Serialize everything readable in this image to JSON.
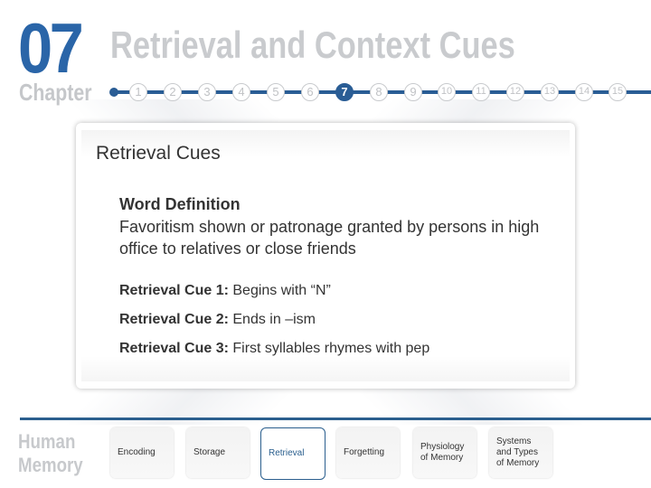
{
  "header": {
    "chapter_number": "07",
    "chapter_label": "Chapter",
    "title": "Retrieval and Context Cues",
    "steps": [
      "1",
      "2",
      "3",
      "4",
      "5",
      "6",
      "7",
      "8",
      "9",
      "10",
      "11",
      "12",
      "13",
      "14",
      "15"
    ],
    "active_step": "7"
  },
  "card": {
    "title": "Retrieval Cues",
    "definition_heading": "Word Definition",
    "definition_text": "Favoritism shown or patronage granted by persons in high office to relatives or close friends",
    "cues": [
      {
        "label": "Retrieval Cue 1:",
        "text": " Begins with “N”"
      },
      {
        "label": "Retrieval Cue 2:",
        "text": " Ends in –ism"
      },
      {
        "label": "Retrieval Cue 3:",
        "text": " First syllables rhymes with pep"
      }
    ]
  },
  "footer": {
    "section_line1": "Human",
    "section_line2": "Memory",
    "nav": [
      {
        "label": "Encoding",
        "active": false
      },
      {
        "label": "Storage",
        "active": false
      },
      {
        "label": "Retrieval",
        "active": true
      },
      {
        "label": "Forgetting",
        "active": false
      },
      {
        "label": "Physiology of Memory",
        "active": false
      },
      {
        "label": "Systems and Types of Memory",
        "active": false
      }
    ]
  },
  "colors": {
    "brand_blue": "#2a65a8",
    "nav_line": "#2b5f8e",
    "muted_gray": "#c7c9cc"
  }
}
